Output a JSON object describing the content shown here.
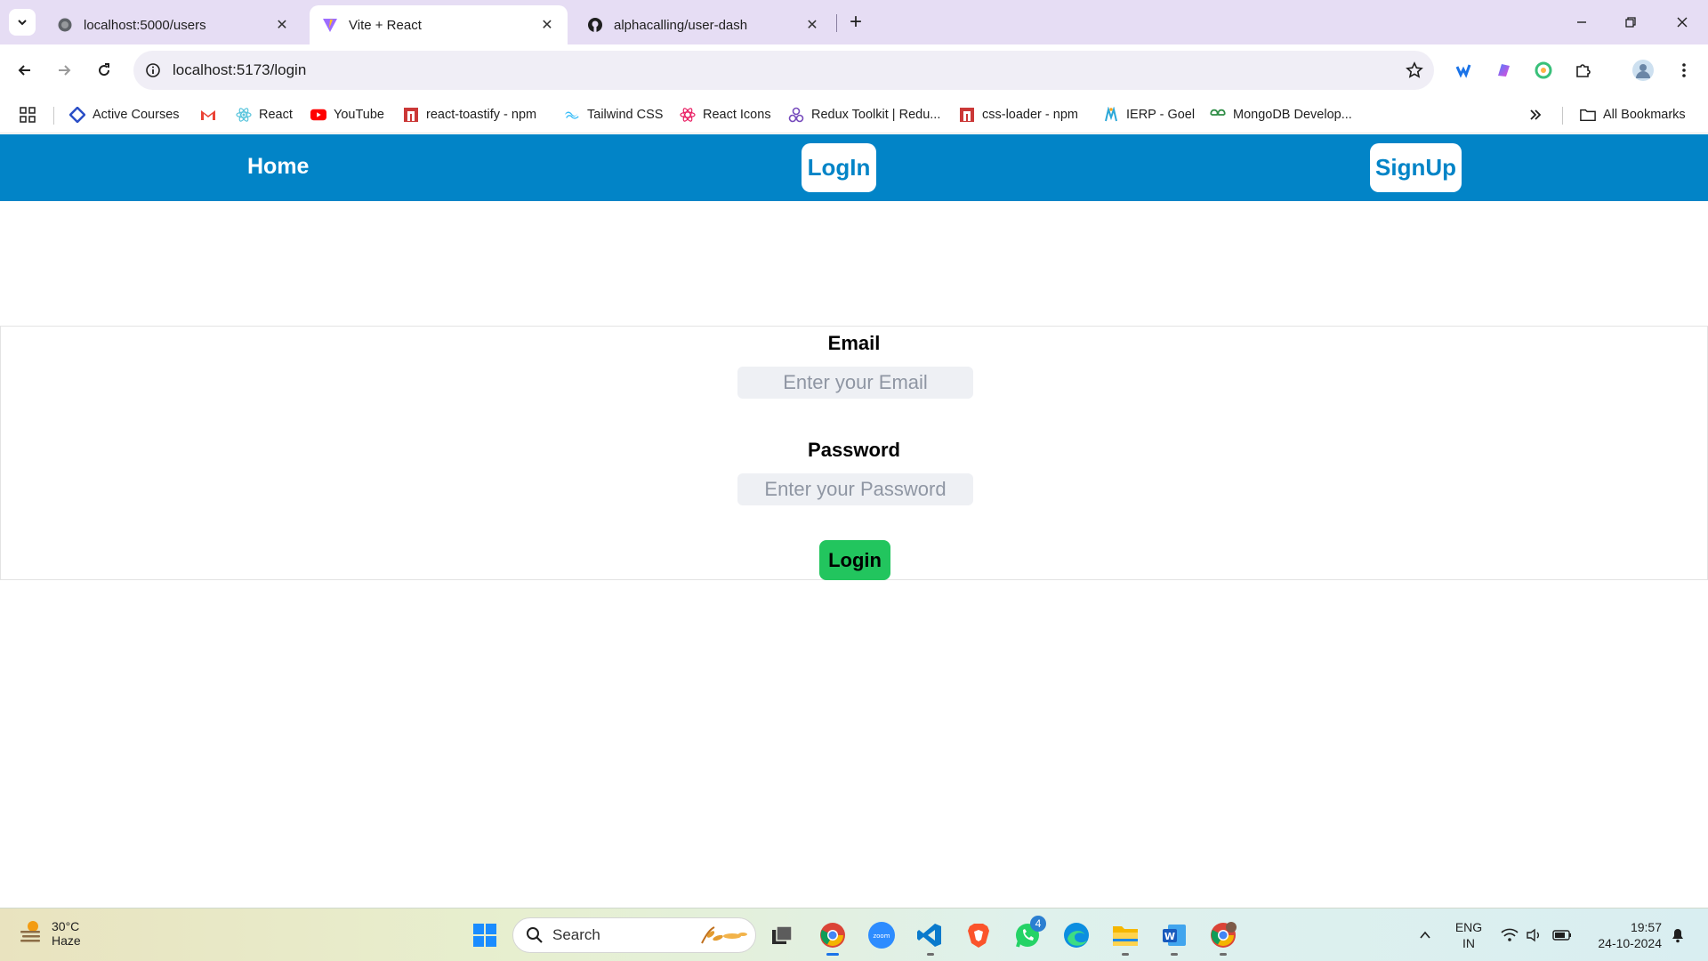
{
  "browser": {
    "tabs": [
      {
        "title": "localhost:5000/users",
        "icon": "globe-icon",
        "active": false
      },
      {
        "title": "Vite + React",
        "icon": "vite-icon",
        "active": true
      },
      {
        "title": "alphacalling/user-dash",
        "icon": "github-icon",
        "active": false
      }
    ],
    "url": "localhost:5173/login",
    "bookmarks": [
      {
        "label": "Active Courses",
        "icon": "course-icon"
      },
      {
        "label": "",
        "icon": "gmail-icon"
      },
      {
        "label": "React",
        "icon": "react-icon"
      },
      {
        "label": "YouTube",
        "icon": "youtube-icon"
      },
      {
        "label": "react-toastify - npm",
        "icon": "npm-icon"
      },
      {
        "label": "Tailwind CSS",
        "icon": "tailwind-icon"
      },
      {
        "label": "React Icons",
        "icon": "react-icons-icon"
      },
      {
        "label": "Redux Toolkit | Redu...",
        "icon": "redux-icon"
      },
      {
        "label": "css-loader - npm",
        "icon": "npm-icon"
      },
      {
        "label": "IERP - Goel",
        "icon": "ierp-icon"
      },
      {
        "label": "MongoDB Develop...",
        "icon": "geeks-icon"
      }
    ],
    "all_bookmarks_label": "All Bookmarks"
  },
  "app": {
    "nav": {
      "home": "Home",
      "login": "LogIn",
      "signup": "SignUp",
      "color": "#0284c7"
    },
    "form": {
      "email_label": "Email",
      "email_placeholder": "Enter your Email",
      "password_label": "Password",
      "password_placeholder": "Enter your Password",
      "submit_label": "Login",
      "submit_color": "#22c55e"
    }
  },
  "taskbar": {
    "weather_temp": "30°C",
    "weather_cond": "Haze",
    "search_label": "Search",
    "whatsapp_badge": "4",
    "language": "ENG",
    "region": "IN",
    "time": "19:57",
    "date": "24-10-2024"
  }
}
